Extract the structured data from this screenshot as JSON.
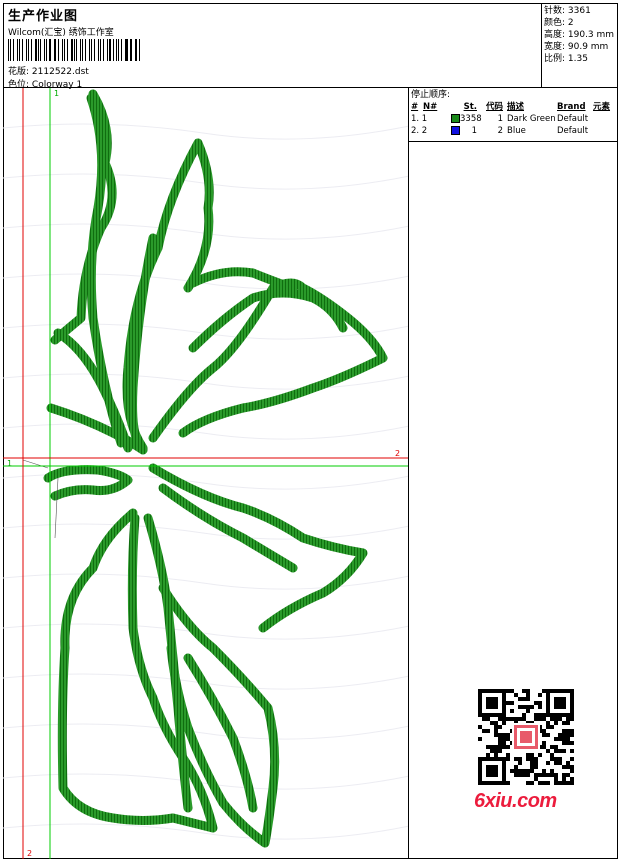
{
  "header": {
    "title": "生产作业图",
    "company": "Wilcom(汇宝) 绣饰工作室",
    "design_label": "花版:",
    "design_value": "2112522.dst",
    "colorway_label": "色位:",
    "colorway_value": "Colorway 1"
  },
  "stats": {
    "stitches": "针数: 3361",
    "colors": "颜色: 2",
    "height": "高度: 190.3 mm",
    "width": "宽度: 90.9 mm",
    "scale": "比例: 1.35"
  },
  "stop_sequence": {
    "title": "停止顺序:",
    "columns": [
      "#",
      "N#",
      "St.",
      "代码",
      "描述",
      "Brand",
      "元素"
    ],
    "rows": [
      {
        "num": "1. 1",
        "color": "#1a8a1a",
        "st": "3358",
        "code": "1",
        "desc": "Dark Green",
        "brand": "Default"
      },
      {
        "num": "2. 2",
        "color": "#1010e0",
        "st": "1",
        "code": "2",
        "desc": "Blue",
        "brand": "Default"
      }
    ]
  },
  "guides": {
    "green_vertical_label": "1",
    "green_horizontal_label": "1",
    "red_horizontal_label": "2",
    "red_vertical_label": "2"
  },
  "colors": {
    "thread_green": "#1a8a1a",
    "guide_red": "#e00000",
    "guide_green": "#00cc00"
  },
  "watermark": {
    "text": "6xiu.com"
  }
}
